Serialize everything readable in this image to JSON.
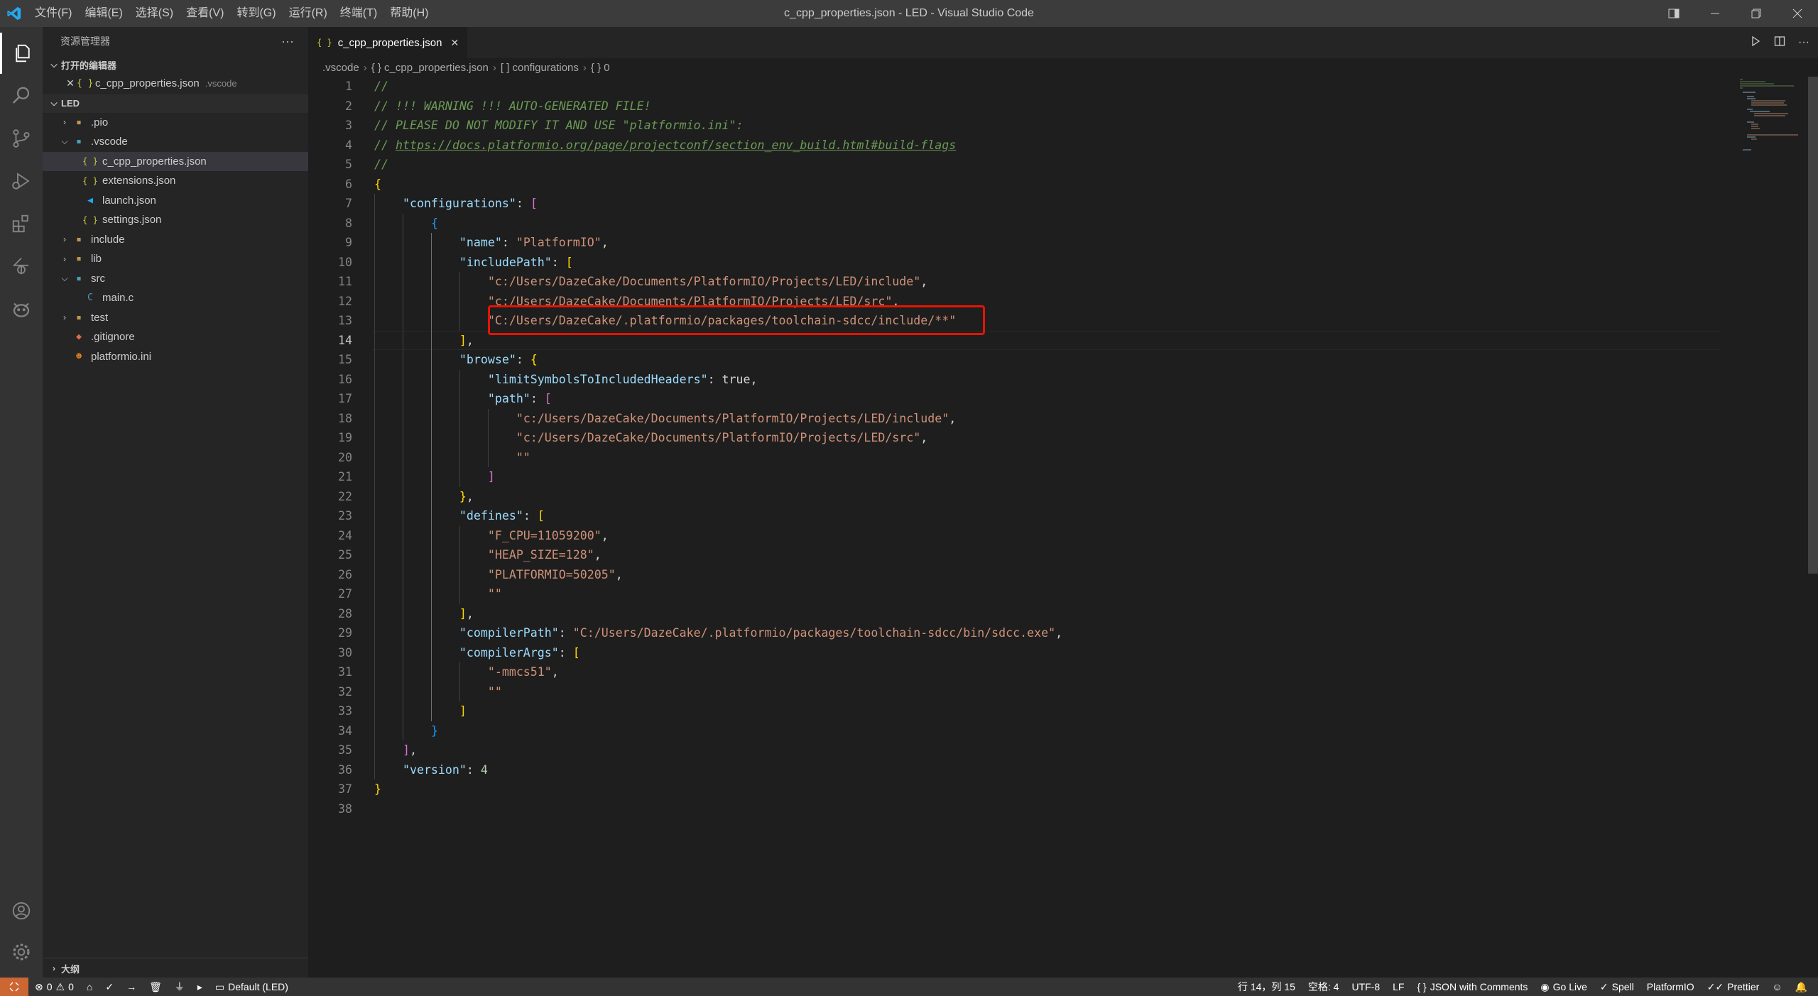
{
  "window": {
    "title": "c_cpp_properties.json - LED - Visual Studio Code",
    "menus": [
      "文件(F)",
      "编辑(E)",
      "选择(S)",
      "查看(V)",
      "转到(G)",
      "运行(R)",
      "终端(T)",
      "帮助(H)"
    ]
  },
  "activity_bar": {
    "items": [
      "explorer-icon",
      "search-icon",
      "source-control-icon",
      "run-debug-icon",
      "extensions-icon",
      "remote-icon",
      "platformio-icon"
    ],
    "bottom": [
      "accounts-icon",
      "settings-gear-icon"
    ]
  },
  "sidebar": {
    "title": "资源管理器",
    "more": "···",
    "open_editors_label": "打开的编辑器",
    "open_editor": {
      "name": "c_cpp_properties.json",
      "desc": ".vscode"
    },
    "workspace_label": "LED",
    "tree": [
      {
        "name": ".pio",
        "type": "folder",
        "indent": 0
      },
      {
        "name": ".vscode",
        "type": "folder-open",
        "indent": 0
      },
      {
        "name": "c_cpp_properties.json",
        "type": "json",
        "indent": 1,
        "selected": true
      },
      {
        "name": "extensions.json",
        "type": "json",
        "indent": 1
      },
      {
        "name": "launch.json",
        "type": "vscode",
        "indent": 1
      },
      {
        "name": "settings.json",
        "type": "json",
        "indent": 1
      },
      {
        "name": "include",
        "type": "folder",
        "indent": 0
      },
      {
        "name": "lib",
        "type": "folder",
        "indent": 0
      },
      {
        "name": "src",
        "type": "folder-open",
        "indent": 0
      },
      {
        "name": "main.c",
        "type": "c",
        "indent": 1
      },
      {
        "name": "test",
        "type": "folder",
        "indent": 0
      },
      {
        "name": ".gitignore",
        "type": "git",
        "indent": 0
      },
      {
        "name": "platformio.ini",
        "type": "pio",
        "indent": 0
      }
    ],
    "outline_label": "大纲"
  },
  "tab": {
    "label": "c_cpp_properties.json",
    "close": "✕"
  },
  "breadcrumb": [
    ".vscode",
    "{ } c_cpp_properties.json",
    "[ ] configurations",
    "{ } 0"
  ],
  "editor": {
    "current_line": 14,
    "lines": [
      "//",
      "// !!! WARNING !!! AUTO-GENERATED FILE!",
      "// PLEASE DO NOT MODIFY IT AND USE \"platformio.ini\":",
      "// https://docs.platformio.org/page/projectconf/section_env_build.html#build-flags",
      "//",
      "{",
      "    \"configurations\": [",
      "        {",
      "            \"name\": \"PlatformIO\",",
      "            \"includePath\": [",
      "                \"c:/Users/DazeCake/Documents/PlatformIO/Projects/LED/include\",",
      "                \"c:/Users/DazeCake/Documents/PlatformIO/Projects/LED/src\",",
      "                \"C:/Users/DazeCake/.platformio/packages/toolchain-sdcc/include/**\"",
      "            ],",
      "            \"browse\": {",
      "                \"limitSymbolsToIncludedHeaders\": true,",
      "                \"path\": [",
      "                    \"c:/Users/DazeCake/Documents/PlatformIO/Projects/LED/include\",",
      "                    \"c:/Users/DazeCake/Documents/PlatformIO/Projects/LED/src\",",
      "                    \"\"",
      "                ]",
      "            },",
      "            \"defines\": [",
      "                \"F_CPU=11059200\",",
      "                \"HEAP_SIZE=128\",",
      "                \"PLATFORMIO=50205\",",
      "                \"\"",
      "            ],",
      "            \"compilerPath\": \"C:/Users/DazeCake/.platformio/packages/toolchain-sdcc/bin/sdcc.exe\",",
      "            \"compilerArgs\": [",
      "                \"-mmcs51\",",
      "                \"\"",
      "            ]",
      "        }",
      "    ],",
      "    \"version\": 4",
      "}",
      ""
    ]
  },
  "status_bar": {
    "errors": "0",
    "warnings": "0",
    "env": "Default (LED)",
    "position": "行 14，列 15",
    "indent": "空格: 4",
    "encoding": "UTF-8",
    "eol": "LF",
    "language": "JSON with Comments",
    "golive": "Go Live",
    "spell": "Spell",
    "platformio": "PlatformIO",
    "prettier": "Prettier"
  },
  "colors": {
    "accent_remote": "#cc6633",
    "highlight_box": "#e51400",
    "statusbar": "#333333"
  }
}
